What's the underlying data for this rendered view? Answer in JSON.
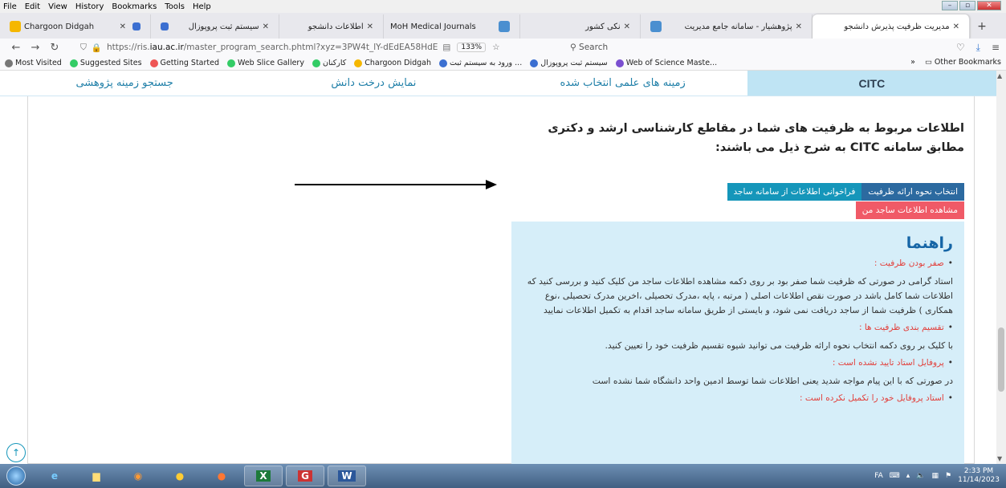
{
  "menu": [
    "File",
    "Edit",
    "View",
    "History",
    "Bookmarks",
    "Tools",
    "Help"
  ],
  "tabs": [
    {
      "label": "Chargoon Didgah",
      "color": "#f5b700"
    },
    {
      "label": "سیستم ثبت پروپوزال",
      "color": "#3b6fd1"
    },
    {
      "label": "اطلاعات دانشجو",
      "color": "#3b6fd1"
    },
    {
      "label": "MoH Medical Journals",
      "color": "#888"
    },
    {
      "label": "نکی کشور",
      "color": "#4a8fd0"
    },
    {
      "label": "پژوهشیار - سامانه جامع مدیریت",
      "color": "#4a8fd0"
    },
    {
      "label": "مدیریت ظرفیت پذیرش دانشجو",
      "color": "#4a8fd0"
    }
  ],
  "url": {
    "prefix": "https://ris.",
    "host": "iau.ac.ir",
    "path": "/master_program_search.phtml?xyz=3PW4t_lY-dEdEA58HdE",
    "zoom": "133%"
  },
  "search_placeholder": "Search",
  "bookmarks": [
    {
      "label": "Most Visited",
      "color": "#666"
    },
    {
      "label": "Suggested Sites",
      "color": "#3c6"
    },
    {
      "label": "Getting Started",
      "color": "#e55"
    },
    {
      "label": "Web Slice Gallery",
      "color": "#3c6"
    },
    {
      "label": "کارکنان",
      "color": "#3c6"
    },
    {
      "label": "Chargoon Didgah",
      "color": "#f5b700"
    },
    {
      "label": "ورود به سیستم ثبت ...",
      "color": "#3b6fd1"
    },
    {
      "label": "سیستم ثبت پروپوزال",
      "color": "#3b6fd1"
    },
    {
      "label": "Web of Science Maste...",
      "color": "#7a4fd0"
    }
  ],
  "other_bookmarks": "Other Bookmarks",
  "site_tabs": [
    "جستجو زمینه پژوهشی",
    "نمایش درخت دانش",
    "زمینه های علمی انتخاب شده",
    "CITC"
  ],
  "heading": "اطلاعات مربوط به ظرفیت های شما در مقاطع کارشناسی ارشد و دکتری مطابق سامانه CITC به شرح ذیل می باشند:",
  "buttons": {
    "select": "انتخاب نحوه ارائه ظرفیت",
    "fetch": "فراخوانی اطلاعات از سامانه ساجد",
    "view": "مشاهده اطلاعات ساجد من"
  },
  "guide": {
    "title": "راهنما",
    "s1": "صفر بودن ظرفیت :",
    "p1": "استاد گرامی در صورتی که ظرفیت شما صفر بود بر روی دکمه مشاهده اطلاعات ساجد من کلیک کنید و بررسی کنید که اطلاعات شما کامل باشد در صورت نقص اطلاعات اصلی ( مرتبه ، پایه ،مدرک تحصیلی ،اخرین مدرک تحصیلی ،نوع همکاری ) ظرفیت شما از ساجد دریافت نمی شود، و بایستی از طریق سامانه ساجد اقدام به تکمیل اطلاعات نمایید",
    "s2": "تقسیم بندی ظرفیت ها :",
    "p2": "با کلیک بر روی دکمه انتخاب نحوه ارائه ظرفیت می توانید شیوه تقسیم ظرفیت خود را تعیین کنید.",
    "s3": "پروفایل استاد تایید نشده است :",
    "p3": "در صورتی که با این پیام مواجه شدید یعنی اطلاعات شما توسط ادمین واحد دانشگاه شما نشده است",
    "s4": "استاد پروفایل خود را تکمیل نکرده است :"
  },
  "taskbar": {
    "lang": "FA",
    "time": "2:33 PM",
    "date": "11/14/2023"
  }
}
